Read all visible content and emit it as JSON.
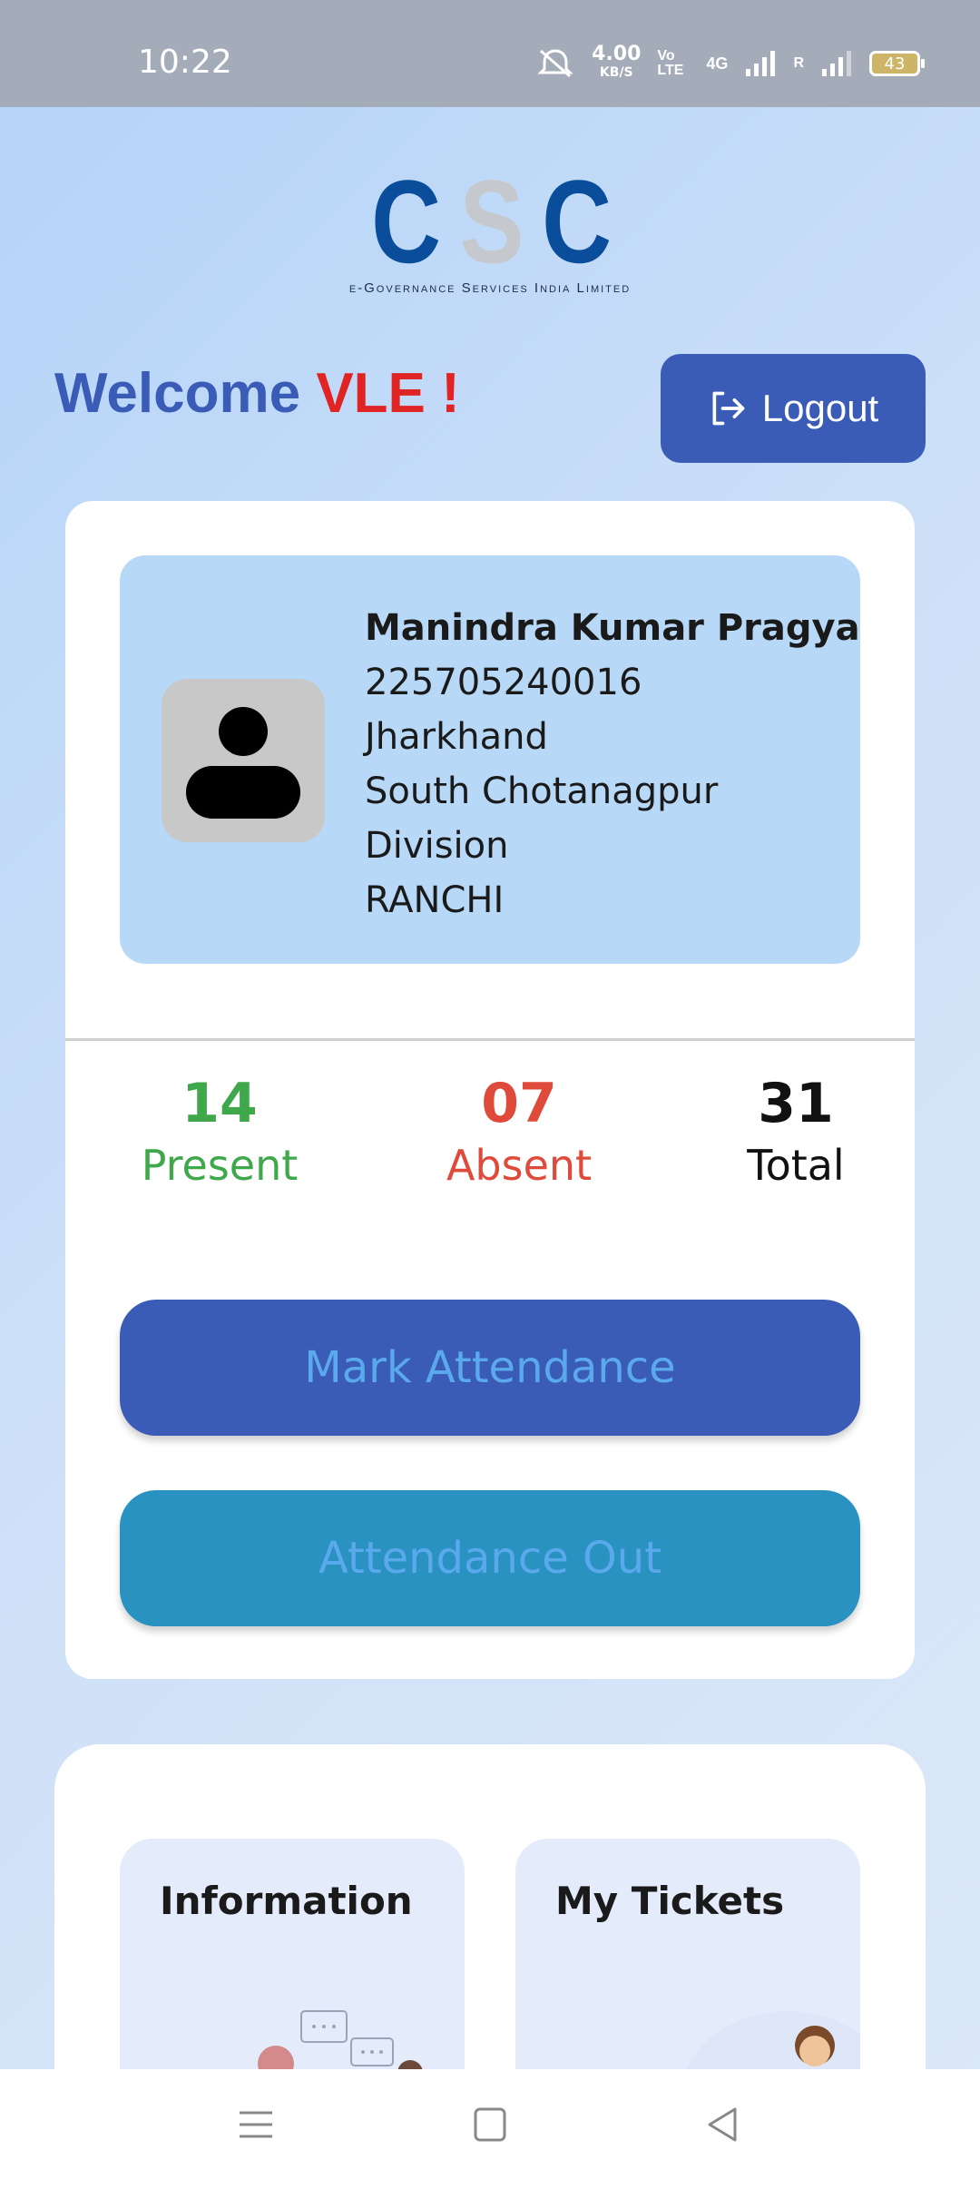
{
  "status_bar": {
    "time": "10:22",
    "net_speed": "4.00",
    "net_unit": "KB/S",
    "volte": "Vo LTE",
    "network": "4G",
    "roaming": "R",
    "battery": "43"
  },
  "logo": {
    "letters": [
      "C",
      "S",
      "C"
    ],
    "subtitle": "e-Governance Services India Limited"
  },
  "header": {
    "welcome": "Welcome",
    "vle": "VLE !",
    "logout_label": "Logout"
  },
  "profile": {
    "name": "Manindra Kumar Pragya",
    "id": "225705240016",
    "state": "Jharkhand",
    "division_line1": "South Chotanagpur",
    "division_line2": "Division",
    "district": "RANCHI"
  },
  "stats": {
    "present_count": "14",
    "present_label": "Present",
    "absent_count": "07",
    "absent_label": "Absent",
    "total_count": "31",
    "total_label": "Total"
  },
  "actions": {
    "mark_attendance": "Mark Attendance",
    "attendance_out": "Attendance Out"
  },
  "tiles": {
    "information": "Information",
    "my_tickets": "My Tickets"
  },
  "colors": {
    "primary": "#3a5cb6",
    "secondary": "#2a92c0",
    "present": "#3fa84a",
    "absent": "#e04a3a",
    "accent_red": "#e02424"
  }
}
